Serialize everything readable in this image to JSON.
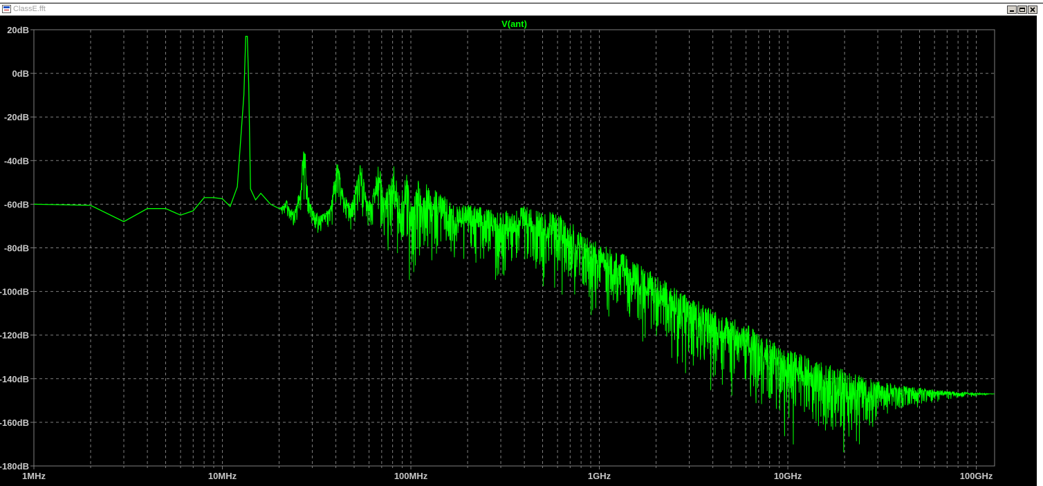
{
  "window": {
    "title": "ClassE.fft",
    "min_label": "_",
    "max_label": "□",
    "close_label": "×"
  },
  "colors": {
    "background": "#000000",
    "grid": "#808080",
    "trace": "#00ff00",
    "axis_text": "#c8c8c8"
  },
  "chart_data": {
    "type": "line",
    "title": "V(ant)",
    "xscale": "log",
    "xlim_hz": [
      1000000,
      125000000000
    ],
    "ylim_db": [
      -180,
      20
    ],
    "grid": true,
    "x_ticks": [
      {
        "value": 1000000,
        "label": "1MHz"
      },
      {
        "value": 10000000,
        "label": "10MHz"
      },
      {
        "value": 100000000,
        "label": "100MHz"
      },
      {
        "value": 1000000000,
        "label": "1GHz"
      },
      {
        "value": 10000000000,
        "label": "10GHz"
      },
      {
        "value": 100000000000,
        "label": "100GHz"
      }
    ],
    "y_ticks": [
      {
        "value": 20,
        "label": "20dB"
      },
      {
        "value": 0,
        "label": "0dB"
      },
      {
        "value": -20,
        "label": "-20dB"
      },
      {
        "value": -40,
        "label": "-40dB"
      },
      {
        "value": -60,
        "label": "-60dB"
      },
      {
        "value": -80,
        "label": "-80dB"
      },
      {
        "value": -100,
        "label": "-100dB"
      },
      {
        "value": -120,
        "label": "-120dB"
      },
      {
        "value": -140,
        "label": "-140dB"
      },
      {
        "value": -160,
        "label": "-160dB"
      },
      {
        "value": -180,
        "label": "-180dB"
      }
    ],
    "series": [
      {
        "name": "V(ant)",
        "x_hz": [
          1000000,
          2000000,
          3000000,
          4000000,
          5000000,
          6000000,
          7000000,
          8000000,
          9000000,
          10000000,
          11000000,
          12000000,
          13000000,
          13300000,
          13560000,
          13800000,
          14100000,
          15000000,
          16000000,
          18000000,
          20000000,
          22000000,
          24000000,
          26000000,
          27120000,
          28500000,
          30000000,
          33000000,
          37000000,
          40680000,
          44000000,
          48000000,
          54240000,
          58000000,
          62000000,
          67800000,
          72000000,
          81360000,
          88000000,
          94920000,
          101000000,
          108480000,
          115000000,
          122040000,
          130000000,
          135600000,
          149160000,
          162720000,
          176280000,
          200000000,
          250000000,
          300000000,
          350000000,
          400000000,
          450000000,
          500000000,
          600000000,
          700000000,
          800000000,
          900000000,
          1000000000,
          1300000000,
          1600000000,
          2000000000,
          2500000000,
          3000000000,
          4000000000,
          5000000000,
          6000000000,
          7000000000,
          8000000000,
          10000000000,
          12000000000,
          15000000000,
          20000000000,
          25000000000,
          30000000000,
          40000000000,
          50000000000,
          60000000000,
          80000000000,
          100000000000,
          125000000000
        ],
        "upper_db": [
          -60,
          -60.5,
          -68,
          -62,
          -62,
          -65,
          -63,
          -57,
          -57,
          -57.5,
          -61,
          -52,
          -10,
          17,
          17,
          -5,
          -53,
          -58,
          -55,
          -60,
          -62,
          -58,
          -63,
          -52,
          -28,
          -55,
          -62,
          -65,
          -62,
          -40,
          -55,
          -60,
          -40,
          -56,
          -58,
          -40,
          -57,
          -42,
          -58,
          -44,
          -60,
          -46,
          -60,
          -49,
          -60,
          -52,
          -56,
          -59,
          -61,
          -60,
          -62,
          -63,
          -62,
          -60,
          -63,
          -63,
          -64,
          -68,
          -72,
          -75,
          -78,
          -82,
          -87,
          -92,
          -98,
          -102,
          -108,
          -112,
          -115,
          -118,
          -122,
          -126,
          -129,
          -132,
          -136,
          -139,
          -141,
          -143,
          -144,
          -145,
          -146,
          -146.5,
          -147
        ],
        "lower_db": [
          -60,
          -60.5,
          -68,
          -62,
          -62,
          -65,
          -63,
          -57,
          -57,
          -57.5,
          -61,
          -52,
          -10,
          17,
          17,
          -5,
          -53,
          -58,
          -55,
          -60,
          -62,
          -70,
          -73,
          -68,
          -60,
          -68,
          -74,
          -76,
          -72,
          -66,
          -70,
          -72,
          -66,
          -76,
          -78,
          -74,
          -84,
          -80,
          -95,
          -88,
          -105,
          -92,
          -90,
          -88,
          -90,
          -88,
          -88,
          -90,
          -90,
          -88,
          -90,
          -100,
          -98,
          -90,
          -96,
          -100,
          -100,
          -105,
          -110,
          -112,
          -110,
          -118,
          -125,
          -130,
          -135,
          -140,
          -146,
          -150,
          -155,
          -158,
          -165,
          -170,
          -172,
          -175,
          -178,
          -170,
          -165,
          -158,
          -155,
          -152,
          -150,
          -148,
          -147
        ]
      }
    ],
    "annotations": []
  }
}
